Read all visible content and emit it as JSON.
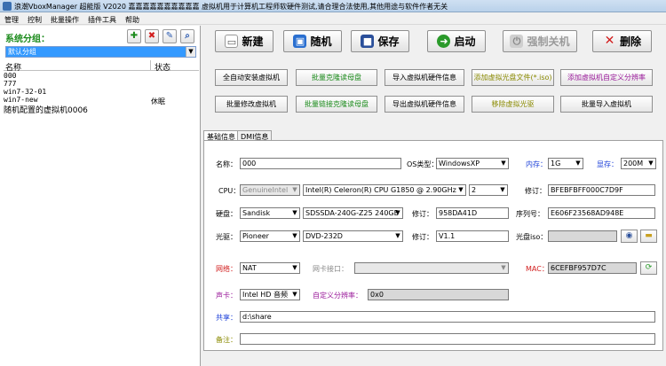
{
  "window": {
    "title": "浪潮VboxManager 超能版 V2020 嘉嘉嘉嘉嘉嘉嘉嘉嘉嘉 虚拟机用于计算机工程师软硬件测试,请合理合法使用,其他用途与软件作者无关"
  },
  "menu": [
    "管理",
    "控制",
    "批量操作",
    "插件工具",
    "帮助"
  ],
  "sidebar": {
    "title": "系统分组：",
    "group_select": "默认分组",
    "columns": [
      "名称",
      "状态"
    ],
    "rows": [
      {
        "name": "000",
        "status": ""
      },
      {
        "name": "777",
        "status": ""
      },
      {
        "name": "win7-32-01",
        "status": ""
      },
      {
        "name": "win7-new",
        "status": "休眠"
      },
      {
        "name": "随机配置的虚拟机0006",
        "status": ""
      }
    ]
  },
  "toolbar": {
    "new": "新建",
    "random": "随机",
    "save": "保存",
    "start": "启动",
    "force_off": "强制关机",
    "delete": "删除"
  },
  "actions": {
    "row1": [
      "全自动安装虚拟机",
      "批量克隆读母盘",
      "导入虚拟机硬件信息",
      "添加虚拟光盘文件(*.iso)",
      "添加虚拟机自定义分辨率"
    ],
    "row2": [
      "批量修改虚拟机",
      "批量链接克隆读母盘",
      "导出虚拟机硬件信息",
      "移除虚拟光驱",
      "批量导入虚拟机"
    ]
  },
  "tabs": [
    "基础信息",
    "DMI信息"
  ],
  "form": {
    "name_label": "名称：",
    "name_value": "000",
    "os_label": "OS类型：",
    "os_value": "WindowsXP",
    "mem_label": "内存：",
    "mem_value": "1G",
    "vram_label": "显存：",
    "vram_value": "200M",
    "cpu_label": "CPU：",
    "cpu_vendor": "GenuineIntel",
    "cpu_model": "Intel(R) Celeron(R) CPU G1850 @ 2.90GHz",
    "cpu_cores": "2",
    "cpu_rev_label": "修订：",
    "cpu_rev_value": "BFEBFBFF000C7D9F",
    "disk_label": "硬盘：",
    "disk_brand": "Sandisk",
    "disk_model": "SDSSDA-240G-Z25 240GB",
    "disk_rev_label": "修订：",
    "disk_rev_value": "958DA41D",
    "serial_label": "序列号：",
    "serial_value": "E606F23568AD948E",
    "optical_label": "光驱：",
    "optical_brand": "Pioneer",
    "optical_model": "DVD-232D",
    "optical_rev_label": "修订：",
    "optical_rev_value": "V1.1",
    "iso_label": "光盘iso：",
    "iso_value": "",
    "net_label": "网络：",
    "net_value": "NAT",
    "nic_label": "网卡接口：",
    "nic_value": "",
    "mac_label": "MAC：",
    "mac_value": "6CEFBF957D7C",
    "sound_label": "声卡：",
    "sound_value": "Intel HD 音频",
    "res_label": "自定义分辨率：",
    "res_value": "0x0",
    "share_label": "共享：",
    "share_value": "d:\\share",
    "note_label": "备注：",
    "note_value": ""
  },
  "colors": {
    "green": "#1a8a1a",
    "blue": "#1b3fd8",
    "red": "#d21e1e",
    "purple": "#9a1a9a",
    "olive": "#8a8a00"
  }
}
